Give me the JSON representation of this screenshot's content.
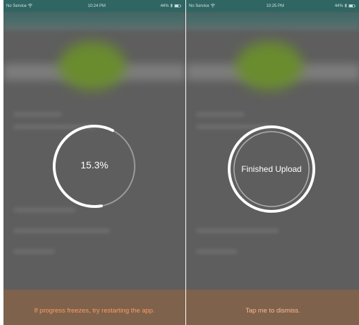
{
  "colors": {
    "status_bar": "#2f6562",
    "overlay": "#5e5e5e",
    "logo_green": "#6a8c2e",
    "banner_bg": "#7e624c",
    "banner_text": "#ff9b63",
    "ring": "#ffffff"
  },
  "left_screen": {
    "status_bar": {
      "carrier": "No Service",
      "wifi_icon": "wifi-icon",
      "time": "10:24 PM",
      "battery": "44%",
      "bluetooth_icon": "bluetooth-icon",
      "battery_icon": "battery-icon"
    },
    "progress": {
      "value": 0.153,
      "label": "15.3%"
    },
    "banner": {
      "text": "If progress freezes, try restarting the app."
    }
  },
  "right_screen": {
    "status_bar": {
      "carrier": "No Service",
      "wifi_icon": "wifi-icon",
      "time": "10:25 PM",
      "battery": "44%",
      "bluetooth_icon": "bluetooth-icon",
      "battery_icon": "battery-icon"
    },
    "completion": {
      "label": "Finished Upload"
    },
    "banner": {
      "text": "Tap me to dismiss."
    }
  }
}
